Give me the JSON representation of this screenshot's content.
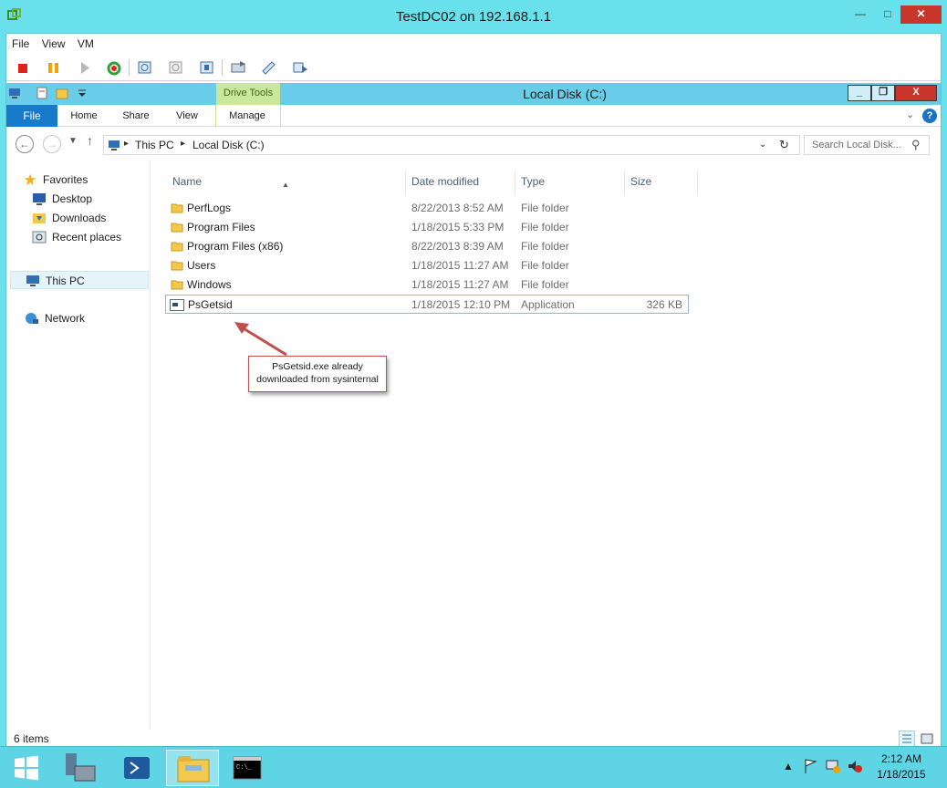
{
  "vm_window": {
    "title": "TestDC02 on 192.168.1.1",
    "menu": [
      "File",
      "View",
      "VM"
    ],
    "controls": {
      "minimize": "—",
      "maximize": "□",
      "close": "✕"
    }
  },
  "explorer": {
    "title": "Local Disk (C:)",
    "context_tab": "Drive Tools",
    "ribbon_tabs": [
      "File",
      "Home",
      "Share",
      "View",
      "Manage"
    ],
    "controls": {
      "minimize": "_",
      "maximize": "❐",
      "close": "X"
    },
    "breadcrumb": [
      "This PC",
      "Local Disk (C:)"
    ],
    "search_placeholder": "Search Local Disk...",
    "nav": {
      "favorites": "Favorites",
      "desktop": "Desktop",
      "downloads": "Downloads",
      "recent": "Recent places",
      "this_pc": "This PC",
      "network": "Network"
    },
    "columns": [
      "Name",
      "Date modified",
      "Type",
      "Size"
    ],
    "files": [
      {
        "name": "PerfLogs",
        "date": "8/22/2013 8:52 AM",
        "type": "File folder",
        "size": ""
      },
      {
        "name": "Program Files",
        "date": "1/18/2015 5:33 PM",
        "type": "File folder",
        "size": ""
      },
      {
        "name": "Program Files (x86)",
        "date": "8/22/2013 8:39 AM",
        "type": "File folder",
        "size": ""
      },
      {
        "name": "Users",
        "date": "1/18/2015 11:27 AM",
        "type": "File folder",
        "size": ""
      },
      {
        "name": "Windows",
        "date": "1/18/2015 11:27 AM",
        "type": "File folder",
        "size": ""
      },
      {
        "name": "PsGetsid",
        "date": "1/18/2015 12:10 PM",
        "type": "Application",
        "size": "326 KB"
      }
    ],
    "callout": {
      "line1": "PsGetsid.exe already",
      "line2": "downloaded from sysinternal"
    },
    "status": "6 items"
  },
  "taskbar": {
    "time": "2:12 AM",
    "date": "1/18/2015"
  },
  "colors": {
    "desktop": "#69e1ec",
    "explorer_title": "#69cdea",
    "file_tab": "#1979ca",
    "drive_tools": "#cbe79a",
    "close": "#c7352b",
    "callout_border": "#c0504d"
  }
}
